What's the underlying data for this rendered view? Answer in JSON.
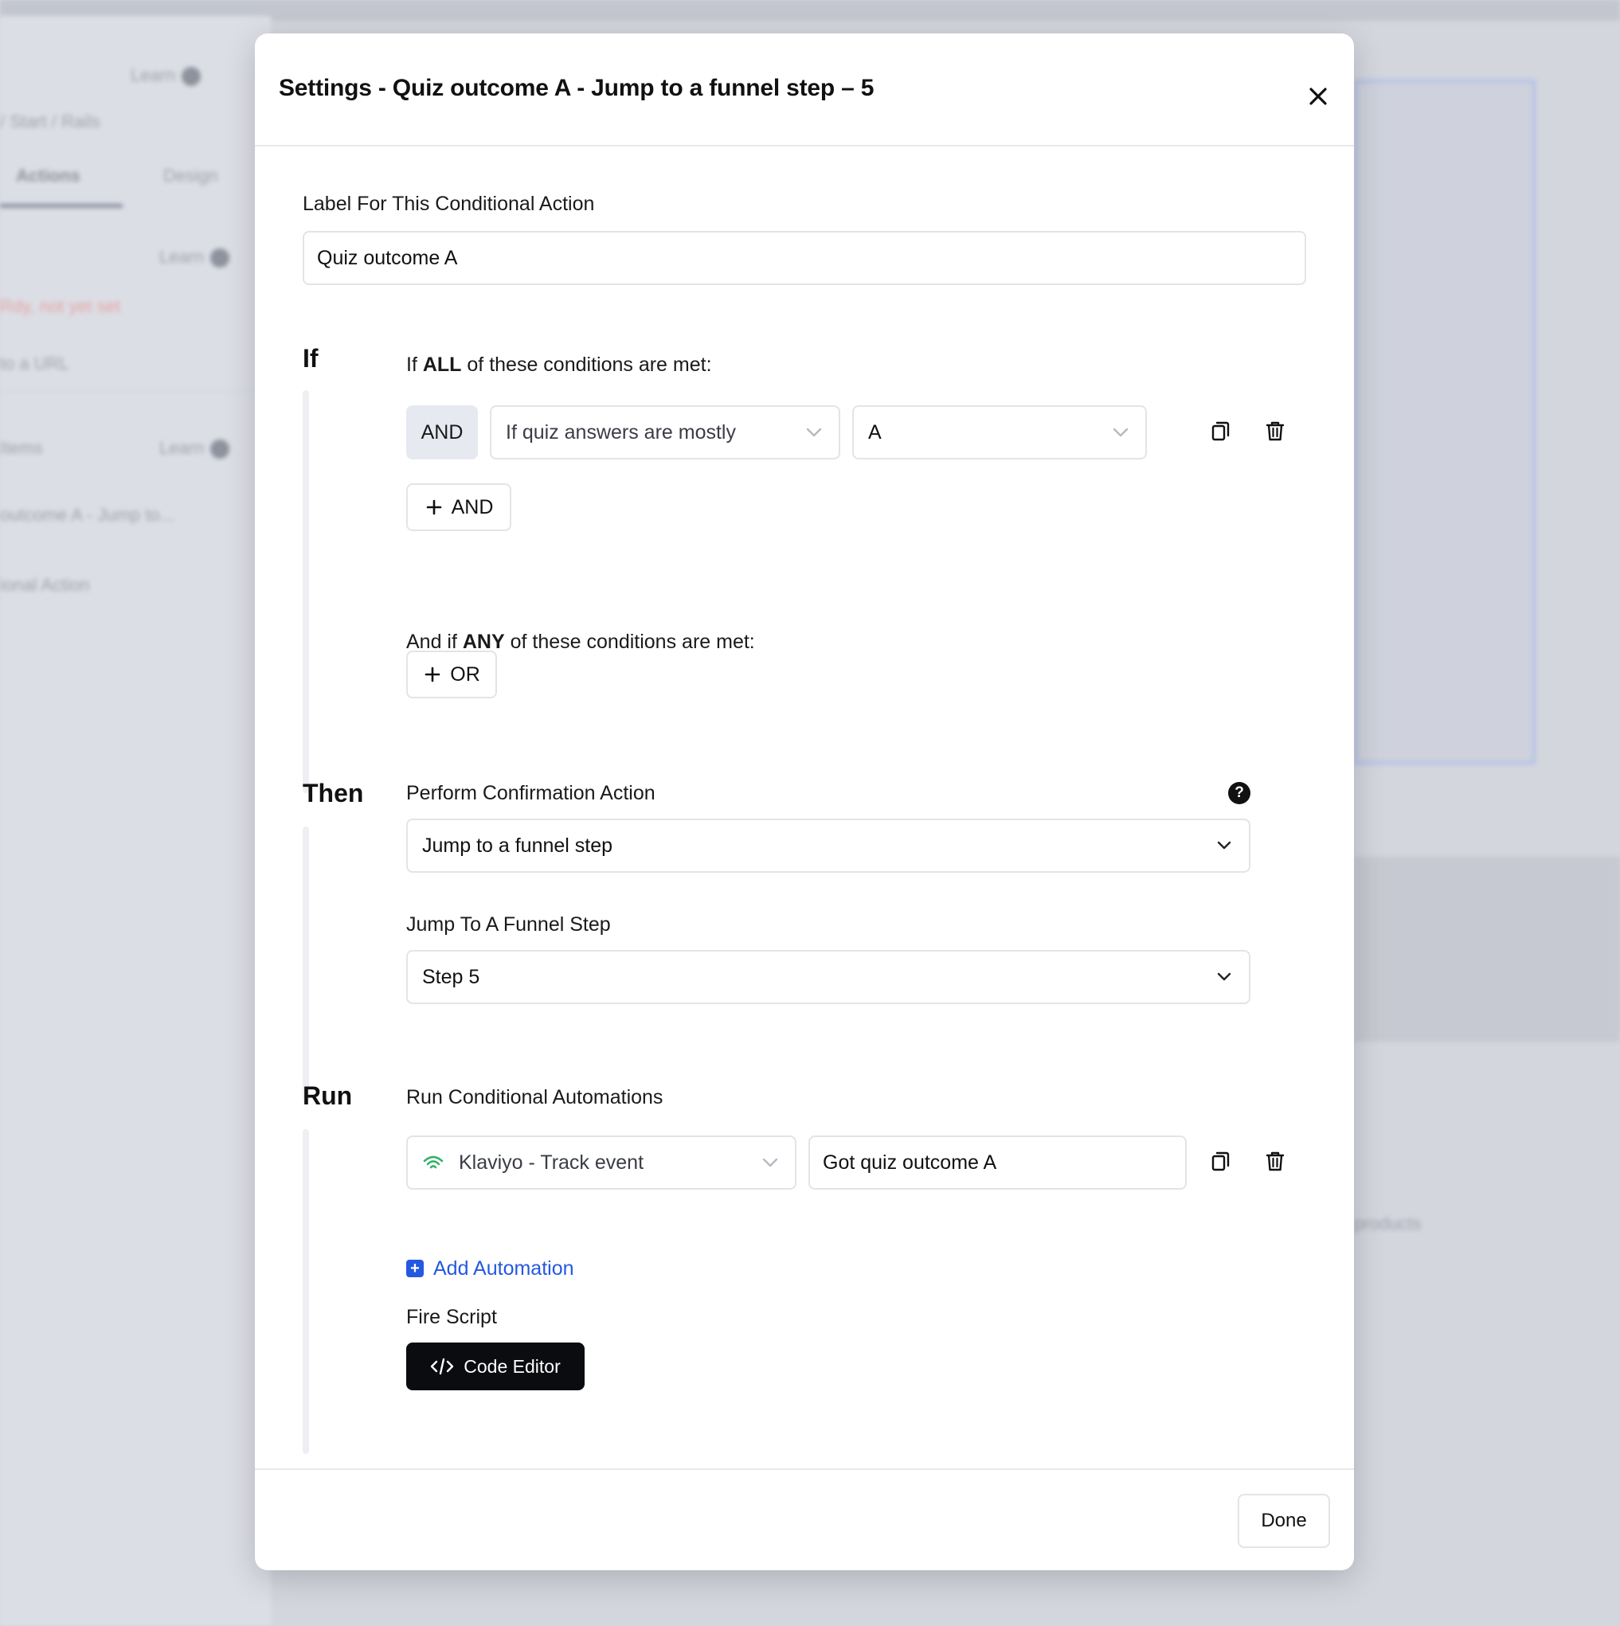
{
  "background": {
    "top_label": "Learn",
    "breadcrumb": "/ Start / Rails",
    "tabs": [
      "Actions",
      "Design"
    ],
    "learn_1": "Learn",
    "warning_text": "Rdy, not yet set",
    "url_text": "to a URL",
    "items_label": "Items",
    "learn_2": "Learn",
    "item_text": "outcome A - Jump to...",
    "action_text": "ional Action",
    "products_text": "products"
  },
  "modal": {
    "title": "Settings - Quiz outcome A - Jump to a funnel step – 5",
    "label_section": {
      "label": "Label For This Conditional Action",
      "value": "Quiz outcome A"
    },
    "if_section": {
      "heading": "If",
      "all_prefix": "If ",
      "all_bold": "ALL",
      "all_suffix": " of these conditions are met:",
      "and_chip": "AND",
      "condition_field": "If quiz answers are mostly",
      "condition_value": "A",
      "add_and_label": "AND",
      "any_prefix": "And if ",
      "any_bold": "ANY",
      "any_suffix": " of these conditions are met:",
      "add_or_label": "OR"
    },
    "then_section": {
      "heading": "Then",
      "action_label": "Perform Confirmation Action",
      "action_value": "Jump to a funnel step",
      "step_label": "Jump To A Funnel Step",
      "step_value": "Step 5"
    },
    "run_section": {
      "heading": "Run",
      "automations_label": "Run Conditional Automations",
      "automation_type": "Klaviyo - Track event",
      "automation_event": "Got quiz outcome A",
      "add_automation_label": "Add Automation",
      "fire_script_label": "Fire Script",
      "code_editor_label": "Code Editor"
    },
    "done_label": "Done"
  },
  "colors": {
    "accent_blue": "#2458e0",
    "klaviyo_green": "#34b36a",
    "dark_button": "#0b0c10"
  }
}
